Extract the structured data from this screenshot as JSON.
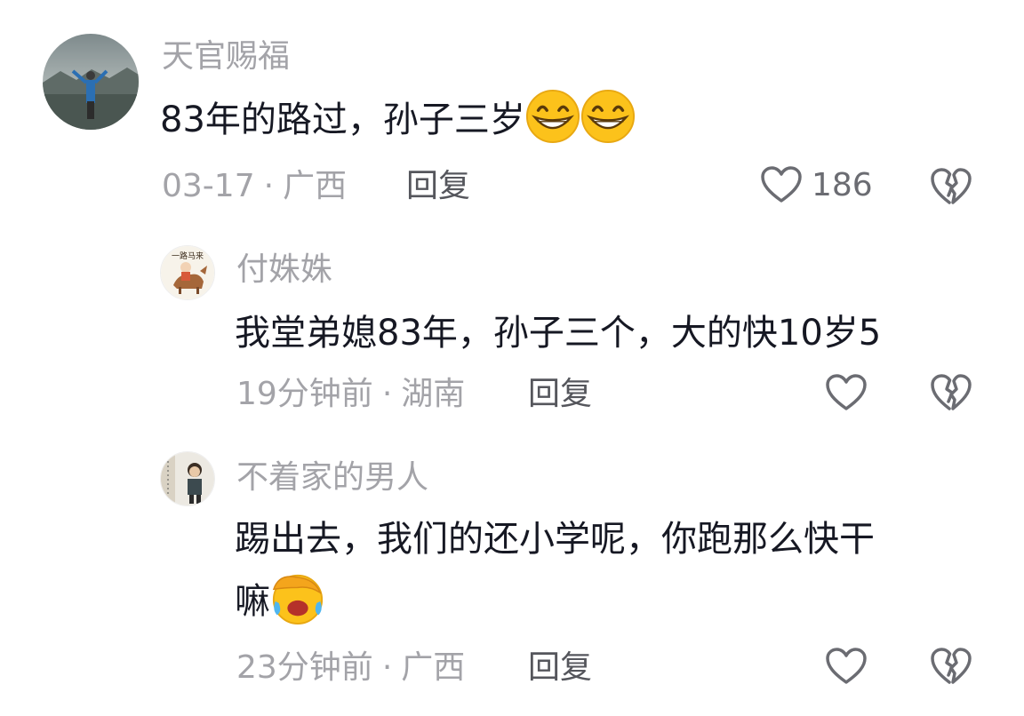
{
  "comments": [
    {
      "username": "天官赐福",
      "text": "83年的路过，孙子三岁",
      "emojis": [
        "grinning-face",
        "grinning-face"
      ],
      "date": "03-17",
      "location": "广西",
      "reply_label": "回复",
      "like_count": "186"
    },
    {
      "username": "付姝姝",
      "avatar_text": "一路马来",
      "text": "我堂弟媳83年，孙子三个，大的快10岁5",
      "date": "19分钟前",
      "location": "湖南",
      "reply_label": "回复",
      "like_count": ""
    },
    {
      "username": "不着家的男人",
      "text_line1": "踢出去，我们的还小学呢，你跑那么快干",
      "text_line2": "嘛",
      "emojis": [
        "facepalm-crying-face"
      ],
      "date": "23分钟前",
      "location": "广西",
      "reply_label": "回复",
      "like_count": ""
    }
  ],
  "separator": "·",
  "colors": {
    "text": "#161823",
    "meta": "#a3a3a8",
    "reply": "#55565c",
    "icon": "#6b6c72"
  }
}
